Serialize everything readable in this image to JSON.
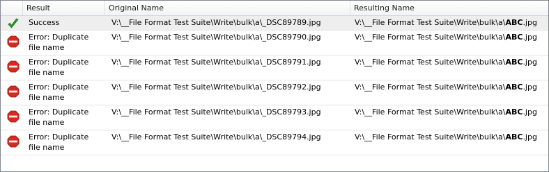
{
  "columns": {
    "result": "Result",
    "original": "Original Name",
    "resulting": "Resulting Name"
  },
  "rows": [
    {
      "status_icon": "checkmark-icon",
      "result": "Success",
      "original": "V:\\__File Format Test Suite\\Write\\bulk\\a\\_DSC89789.jpg",
      "resulting_prefix": "V:\\__File Format Test Suite\\Write\\bulk\\a\\",
      "resulting_bold": "ABC",
      "resulting_ext": ".jpg"
    },
    {
      "status_icon": "stop-icon",
      "result": "Error: Duplicate file name",
      "original": "V:\\__File Format Test Suite\\Write\\bulk\\a\\_DSC89790.jpg",
      "resulting_prefix": "V:\\__File Format Test Suite\\Write\\bulk\\a\\",
      "resulting_bold": "ABC",
      "resulting_ext": ".jpg"
    },
    {
      "status_icon": "stop-icon",
      "result": "Error: Duplicate file name",
      "original": "V:\\__File Format Test Suite\\Write\\bulk\\a\\_DSC89791.jpg",
      "resulting_prefix": "V:\\__File Format Test Suite\\Write\\bulk\\a\\",
      "resulting_bold": "ABC",
      "resulting_ext": ".jpg"
    },
    {
      "status_icon": "stop-icon",
      "result": "Error: Duplicate file name",
      "original": "V:\\__File Format Test Suite\\Write\\bulk\\a\\_DSC89792.jpg",
      "resulting_prefix": "V:\\__File Format Test Suite\\Write\\bulk\\a\\",
      "resulting_bold": "ABC",
      "resulting_ext": ".jpg"
    },
    {
      "status_icon": "stop-icon",
      "result": "Error: Duplicate file name",
      "original": "V:\\__File Format Test Suite\\Write\\bulk\\a\\_DSC89793.jpg",
      "resulting_prefix": "V:\\__File Format Test Suite\\Write\\bulk\\a\\",
      "resulting_bold": "ABC",
      "resulting_ext": ".jpg"
    },
    {
      "status_icon": "stop-icon",
      "result": "Error: Duplicate file name",
      "original": "V:\\__File Format Test Suite\\Write\\bulk\\a\\_DSC89794.jpg",
      "resulting_prefix": "V:\\__File Format Test Suite\\Write\\bulk\\a\\",
      "resulting_bold": "ABC",
      "resulting_ext": ".jpg"
    }
  ],
  "colors": {
    "success": "#2e9a2e",
    "error": "#d42a1f"
  }
}
